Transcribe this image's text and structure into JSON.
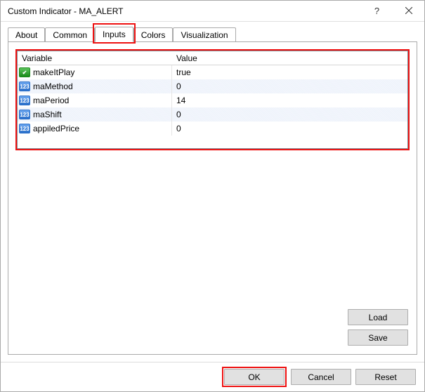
{
  "window": {
    "title": "Custom Indicator - MA_ALERT"
  },
  "tabs": {
    "about": "About",
    "common": "Common",
    "inputs": "Inputs",
    "colors": "Colors",
    "visualization": "Visualization",
    "active": "inputs"
  },
  "grid": {
    "headers": {
      "variable": "Variable",
      "value": "Value"
    },
    "rows": [
      {
        "icon": "bool",
        "name": "makeItPlay",
        "value": "true"
      },
      {
        "icon": "123",
        "name": "maMethod",
        "value": "0"
      },
      {
        "icon": "123",
        "name": "maPeriod",
        "value": "14"
      },
      {
        "icon": "123",
        "name": "maShift",
        "value": "0"
      },
      {
        "icon": "123",
        "name": "appiledPrice",
        "value": "0"
      }
    ]
  },
  "buttons": {
    "load": "Load",
    "save": "Save",
    "ok": "OK",
    "cancel": "Cancel",
    "reset": "Reset"
  }
}
